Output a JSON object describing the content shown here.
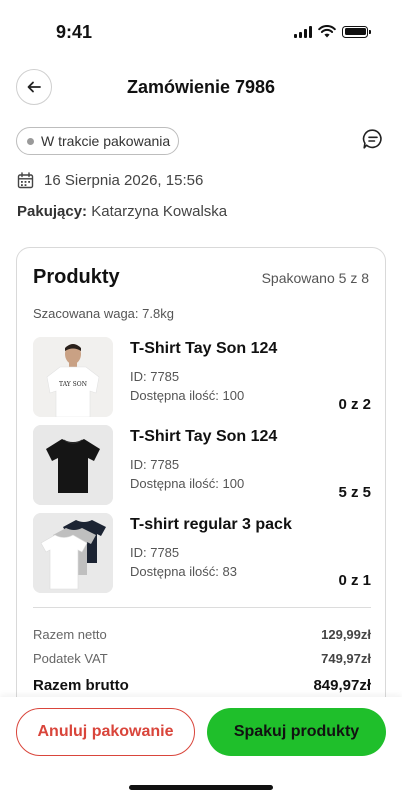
{
  "status_bar": {
    "time": "9:41"
  },
  "header": {
    "title": "Zamówienie 7986",
    "back_icon": "arrow-left-icon"
  },
  "order": {
    "status": "W trakcie pakowania",
    "status_dot_color": "#9a9a9a",
    "chat_icon": "chat-bubble-icon",
    "date_icon": "calendar-icon",
    "date": "16 Sierpnia 2026, 15:56",
    "packer_label": "Pakujący:",
    "packer_name": "Katarzyna Kowalska"
  },
  "products": {
    "title": "Produkty",
    "packed_summary": "Spakowano 5 z 8",
    "estimated_weight": "Szacowana waga: 7.8kg",
    "items": [
      {
        "name": "T-Shirt Tay Son 124",
        "id": "ID: 7785",
        "stock": "Dostępna ilość: 100",
        "quantity": "0 z 2",
        "thumb_logo": "TAY SON"
      },
      {
        "name": "T-Shirt Tay Son 124",
        "id": "ID: 7785",
        "stock": "Dostępna ilość: 100",
        "quantity": "5 z 5"
      },
      {
        "name": "T-shirt regular 3 pack",
        "id": "ID: 7785",
        "stock": "Dostępna ilość: 83",
        "quantity": "0 z 1"
      }
    ]
  },
  "totals": {
    "net_label": "Razem netto",
    "net_value": "129,99zł",
    "vat_label": "Podatek VAT",
    "vat_value": "749,97zł",
    "gross_label": "Razem brutto",
    "gross_value": "849,97zł"
  },
  "actions": {
    "cancel_label": "Anuluj pakowanie",
    "pack_label": "Spakuj produkty"
  },
  "colors": {
    "accent_green": "#1fbf2b",
    "danger_red": "#d9453b"
  }
}
